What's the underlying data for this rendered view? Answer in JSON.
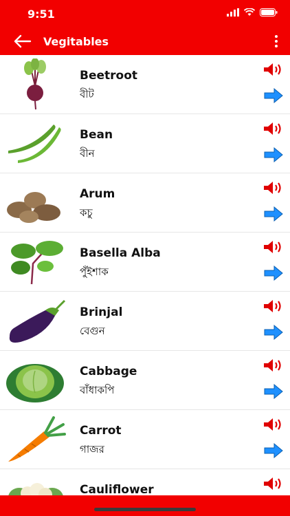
{
  "status": {
    "time": "9:51"
  },
  "header": {
    "title": "Vegitables"
  },
  "items": [
    {
      "name": "Beetroot",
      "bn": "বীট"
    },
    {
      "name": "Bean",
      "bn": "বীন"
    },
    {
      "name": "Arum",
      "bn": "কচু"
    },
    {
      "name": "Basella Alba",
      "bn": "পুঁইশাক"
    },
    {
      "name": "Brinjal",
      "bn": "বেগুন"
    },
    {
      "name": "Cabbage",
      "bn": "বাঁধাকপি"
    },
    {
      "name": "Carrot",
      "bn": "গাজর"
    },
    {
      "name": "Cauliflower",
      "bn": ""
    }
  ],
  "colors": {
    "accent": "#f20000",
    "arrow": "#1e90ff"
  }
}
